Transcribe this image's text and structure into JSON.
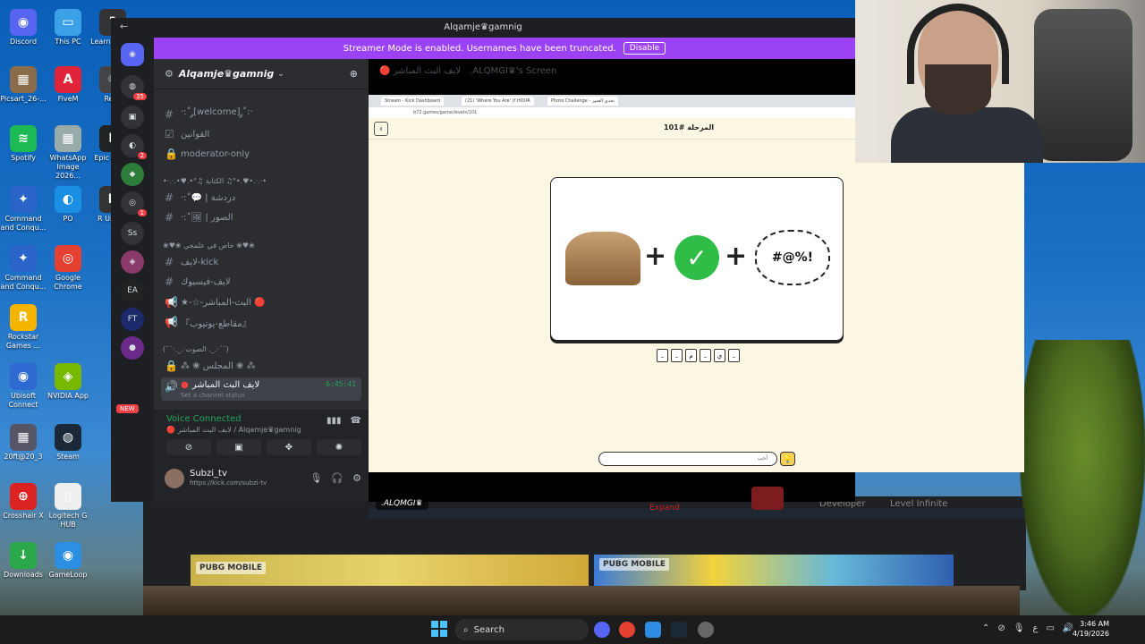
{
  "desktop": {
    "icons": [
      {
        "label": "Discord",
        "color": "#5865f2",
        "glyph": "◉"
      },
      {
        "label": "This PC",
        "color": "#3ba0e6",
        "glyph": "▭"
      },
      {
        "label": "Picsart_26-...",
        "color": "#8a6c4a",
        "glyph": "▦"
      },
      {
        "label": "FiveM",
        "color": "#e0243a",
        "glyph": "A"
      },
      {
        "label": "Spotify",
        "color": "#1db954",
        "glyph": "≋"
      },
      {
        "label": "WhatsApp Image 2026...",
        "color": "#9aa",
        "glyph": "▦"
      },
      {
        "label": "Command and Conqu...",
        "color": "#2a64c8",
        "glyph": "✦"
      },
      {
        "label": "PO",
        "color": "#1a8fe3",
        "glyph": "◐"
      },
      {
        "label": "Command and Conqu...",
        "color": "#2a64c8",
        "glyph": "✦"
      },
      {
        "label": "Google Chrome",
        "color": "#e44133",
        "glyph": "◎"
      },
      {
        "label": "Rockstar Games ...",
        "color": "#f5b400",
        "glyph": "R"
      },
      {
        "label": "Ubisoft Connect",
        "color": "#2e6ad1",
        "glyph": "◉"
      },
      {
        "label": "NVIDIA App",
        "color": "#76b900",
        "glyph": "◈"
      },
      {
        "label": "20ft@20_3",
        "color": "#556",
        "glyph": "▦"
      },
      {
        "label": "Steam",
        "color": "#1b2838",
        "glyph": "◍"
      },
      {
        "label": "Crosshair X",
        "color": "#d22",
        "glyph": "⊕"
      },
      {
        "label": "Logitech G HUB",
        "color": "#eee",
        "glyph": "▯"
      },
      {
        "label": "Downloads",
        "color": "#2aa84a",
        "glyph": "↓"
      },
      {
        "label": "GameLoop",
        "color": "#2d8fe3",
        "glyph": "◉"
      },
      {
        "label": "Learn this ...",
        "color": "#333",
        "glyph": "?"
      },
      {
        "label": "Recy",
        "color": "#444",
        "glyph": "♲"
      },
      {
        "label": "Epic Lau...",
        "color": "#222",
        "glyph": "E"
      },
      {
        "label": "R Unin...",
        "color": "#333",
        "glyph": "R"
      }
    ]
  },
  "discord": {
    "window_title": "Alqamje♛gamnig",
    "banner_text": "Streamer Mode is enabled. Usernames have been truncated.",
    "banner_button": "Disable",
    "server_name": "Alqamje♛gamnig",
    "guild_badges": [
      "35",
      "2",
      "1"
    ],
    "guild_ss": "Ss",
    "guild_new": "NEW",
    "channels": [
      {
        "sym": "#",
        "name": "·:˚ ༘[welcome] ༘˚:·"
      },
      {
        "sym": "☑",
        "name": "القوانين"
      },
      {
        "sym": "🔒",
        "name": "moderator-only"
      },
      {
        "sym": "#",
        "name": "·:˚💬 | دردشة"
      },
      {
        "sym": "#",
        "name": "·:˚🖼 | الصور"
      },
      {
        "sym": "#",
        "name": "لايف-kick"
      },
      {
        "sym": "#",
        "name": "لايف-فيسبوك"
      },
      {
        "sym": "📢",
        "name": "★-☆-البث-المباشر 🔴"
      },
      {
        "sym": "📢",
        "name": "『مقاطع-يوتيوب』"
      },
      {
        "sym": "🔒",
        "name": "⁂ ❀ المجلس ❀ ⁂"
      }
    ],
    "categories": [
      "•·.·.•♥.•°♫ الكتابة ♫°•.♥•.·.·•",
      "❀♥❀ خاص في علمجي ❀♥❀",
      "(¯`·._.·الصوت·._.·´¯)"
    ],
    "active_voice": {
      "name": "لايف البث المباشر",
      "timer": "6:45:41",
      "sub": "Set a channel status"
    },
    "voice_connected": "Voice Connected",
    "voice_sub": "🔴 لايف البث المباشر / Alqamje♛gamnig",
    "user": {
      "name": "Subzi_tv",
      "status": "https://kick.com/subzi-tv"
    },
    "stream_top_channel": "🔴 لايف البث المباشر",
    "stream_top_screen": ".ALQMGI♛'s Screen",
    "streamer_tag": ".ALQMGI♛",
    "expand_label": "Expand"
  },
  "shared_screen": {
    "tabs": [
      "Stream - Kick Dashboard",
      "(21) 'Where You Are' (f HOUR",
      "Photo Challenge - تحدي الصور"
    ],
    "url": "b72.games/game/levels/101",
    "level_title": "المرحلة #101",
    "curse_text": "#@%!",
    "slots": [
      "ـ",
      "ـ",
      "م",
      "ـ",
      "ي",
      "ـ"
    ],
    "answer_placeholder": "أجب",
    "hint_icon": "💡"
  },
  "background_browser": {
    "nav": [
      "Developer",
      "Level Infinite"
    ],
    "banner1": "PUBG MOBILE",
    "banner2": "PUBG MOBILE"
  },
  "taskbar": {
    "search_label": "Search",
    "time": "3:46 AM",
    "date": "4/19/2026",
    "lang": "ع"
  }
}
